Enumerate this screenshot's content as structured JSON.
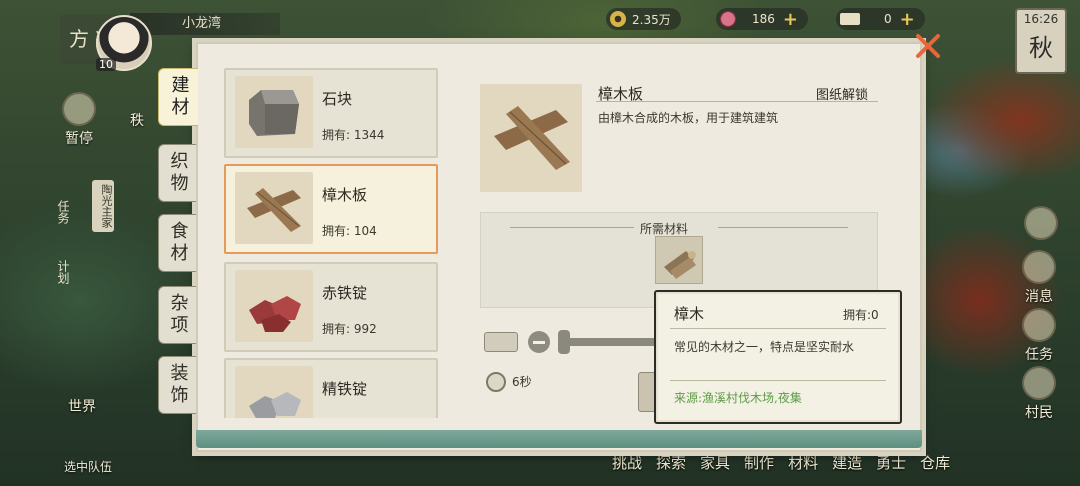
{
  "hud": {
    "region_title": "方兴",
    "player_name": "小龙湾",
    "level": "10",
    "copper": "2.35万",
    "roses": "186",
    "tickets": "0",
    "plus": "+",
    "time": "16:26",
    "season": "秋"
  },
  "left_hud": {
    "btn1": "暂停",
    "btn2": "秩",
    "quest_tag": "陶光主家",
    "quest_label": "任务",
    "plan_label": "计划",
    "world": "世界",
    "team": "选中队伍"
  },
  "right_hud": {
    "news": "消息",
    "tasks": "任务",
    "villagers": "村民"
  },
  "bottom_nav": [
    "挑战",
    "探索",
    "家具",
    "制作",
    "材料",
    "建造",
    "勇士",
    "仓库"
  ],
  "tabs": [
    "建材",
    "织物",
    "食材",
    "杂项",
    "装饰"
  ],
  "items": [
    {
      "name": "石块",
      "owned_label": "拥有:",
      "owned": "1344",
      "icon": "stone-icon"
    },
    {
      "name": "樟木板",
      "owned_label": "拥有:",
      "owned": "104",
      "icon": "plank-icon"
    },
    {
      "name": "赤铁锭",
      "owned_label": "拥有:",
      "owned": "992",
      "icon": "red-iron-ingot-icon"
    },
    {
      "name": "精铁锭",
      "owned_label": "拥有:",
      "owned": "",
      "icon": "iron-ingot-icon"
    }
  ],
  "detail": {
    "name": "樟木板",
    "unlock": "图纸解锁",
    "desc": "由樟木合成的木板，用于建筑建筑",
    "materials_title": "所需材料",
    "time": "6秒"
  },
  "tooltip": {
    "name": "樟木",
    "owned": "拥有:0",
    "desc": "常见的木材之一，特点是坚实耐水",
    "source": "来源:渔溪村伐木场,夜集"
  },
  "colors": {
    "selection_border": "#e59a5c",
    "source_text": "#5d9d45",
    "panel_bg": "#eeeadf"
  }
}
